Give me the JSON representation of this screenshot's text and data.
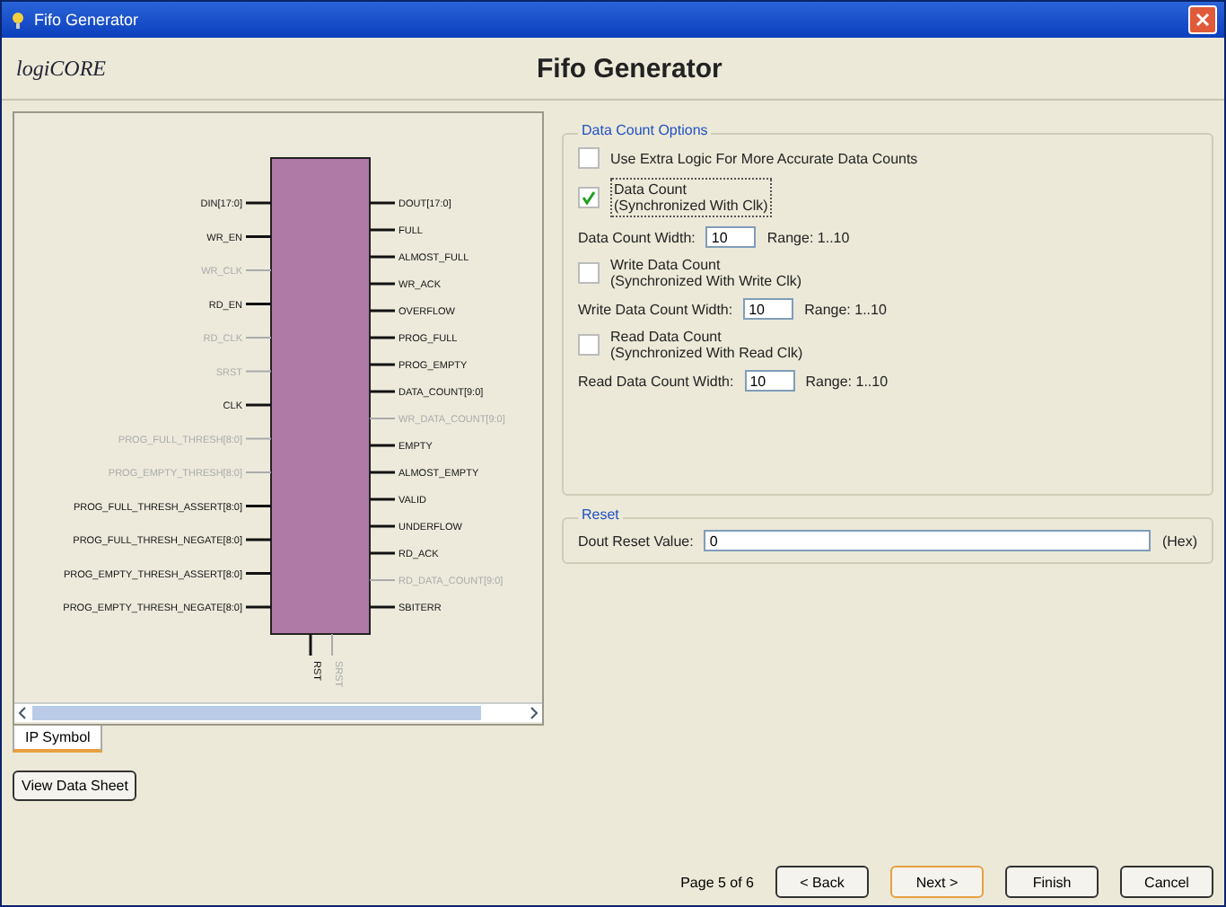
{
  "window": {
    "title": "Fifo Generator"
  },
  "header": {
    "logo": "logiCORE",
    "title": "Fifo Generator"
  },
  "symbol": {
    "left_pins": [
      {
        "label": "DIN[17:0]",
        "active": true
      },
      {
        "label": "WR_EN",
        "active": true
      },
      {
        "label": "WR_CLK",
        "active": false
      },
      {
        "label": "RD_EN",
        "active": true
      },
      {
        "label": "RD_CLK",
        "active": false
      },
      {
        "label": "SRST",
        "active": false
      },
      {
        "label": "CLK",
        "active": true
      },
      {
        "label": "PROG_FULL_THRESH[8:0]",
        "active": false
      },
      {
        "label": "PROG_EMPTY_THRESH[8:0]",
        "active": false
      },
      {
        "label": "PROG_FULL_THRESH_ASSERT[8:0]",
        "active": true
      },
      {
        "label": "PROG_FULL_THRESH_NEGATE[8:0]",
        "active": true
      },
      {
        "label": "PROG_EMPTY_THRESH_ASSERT[8:0]",
        "active": true
      },
      {
        "label": "PROG_EMPTY_THRESH_NEGATE[8:0]",
        "active": true
      }
    ],
    "right_pins": [
      {
        "label": "DOUT[17:0]",
        "active": true
      },
      {
        "label": "FULL",
        "active": true
      },
      {
        "label": "ALMOST_FULL",
        "active": true
      },
      {
        "label": "WR_ACK",
        "active": true
      },
      {
        "label": "OVERFLOW",
        "active": true
      },
      {
        "label": "PROG_FULL",
        "active": true
      },
      {
        "label": "PROG_EMPTY",
        "active": true
      },
      {
        "label": "DATA_COUNT[9:0]",
        "active": true
      },
      {
        "label": "WR_DATA_COUNT[9:0]",
        "active": false
      },
      {
        "label": "EMPTY",
        "active": true
      },
      {
        "label": "ALMOST_EMPTY",
        "active": true
      },
      {
        "label": "VALID",
        "active": true
      },
      {
        "label": "UNDERFLOW",
        "active": true
      },
      {
        "label": "RD_ACK",
        "active": true
      },
      {
        "label": "RD_DATA_COUNT[9:0]",
        "active": false
      },
      {
        "label": "SBITERR",
        "active": true
      }
    ],
    "bottom_pins": [
      {
        "label": "RST",
        "active": true
      },
      {
        "label": "SRST",
        "active": false
      }
    ]
  },
  "symbol_tab": {
    "label": "IP Symbol",
    "selected": true
  },
  "data_sheet_button": "View Data Sheet",
  "data_count_options": {
    "title": "Data Count Options",
    "rows": [
      {
        "kind": "check",
        "label": "Use Extra Logic For More Accurate Data Counts",
        "checked": false
      },
      {
        "kind": "check",
        "label": "Data Count",
        "sublabel": "(Synchronized With Clk)",
        "checked": true
      },
      {
        "kind": "width",
        "label": "Data Count Width:",
        "value": "10",
        "range": "Range: 1..10"
      },
      {
        "kind": "check",
        "label": "Write Data Count",
        "sublabel": "(Synchronized With Write Clk)",
        "checked": false
      },
      {
        "kind": "width",
        "label": "Write Data Count Width:",
        "value": "10",
        "range": "Range: 1..10"
      },
      {
        "kind": "check",
        "label": "Read Data Count",
        "sublabel": "(Synchronized With Read Clk)",
        "checked": false
      },
      {
        "kind": "width",
        "label": "Read Data Count Width:",
        "value": "10",
        "range": "Range: 1..10"
      }
    ]
  },
  "reset": {
    "title": "Reset",
    "label": "Dout Reset Value:",
    "value": "0",
    "unit": "(Hex)"
  },
  "footer": {
    "page": "Page 5 of 6",
    "buttons": [
      "< Back",
      "Next >",
      "Finish",
      "Cancel"
    ]
  }
}
